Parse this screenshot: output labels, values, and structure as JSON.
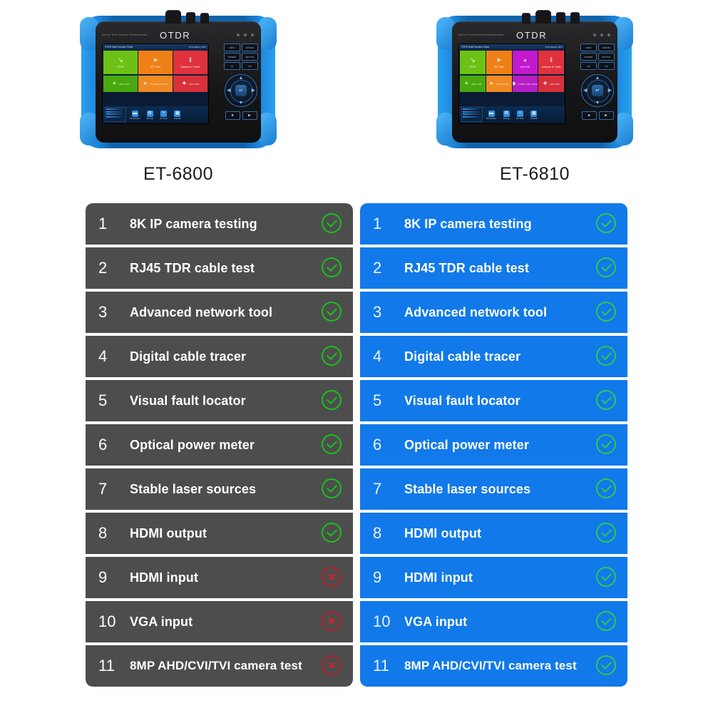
{
  "products": [
    {
      "label": "ET-6800",
      "device": {
        "brand_main": "OTDR",
        "brand_sub": "Optical Time Domain Reflectometer",
        "screen_title": "OTDR Multi-Function Tester",
        "screen_status": "12:06   Battery 86%",
        "tile_columns": 3,
        "tiles_top": [
          {
            "name": "OTDR",
            "icon": "otdr-trace-icon",
            "glyph": "↘",
            "color": "#6cc114"
          },
          {
            "name": "IPC Test",
            "icon": "ipc-camera-icon",
            "glyph": "➤",
            "color": "#ef8018"
          },
          {
            "name": "Network & Cable",
            "icon": "network-cable-icon",
            "glyph": "‖",
            "color": "#e0323c"
          }
        ],
        "tiles_bottom": [
          {
            "name": "Fiber Tool",
            "icon": "fiber-tool-icon",
            "glyph": "✴",
            "color": "#4aa80f"
          },
          {
            "name": "IP Discovery Tool",
            "icon": "discovery-icon",
            "glyph": "➤",
            "color": "#f08a22"
          },
          {
            "name": "Apk APPs",
            "icon": "apps-icon",
            "glyph": "❖",
            "color": "#d8303a"
          }
        ],
        "dock": [
          {
            "label": "File Explorer",
            "icon": "folder-icon",
            "glyph": "▬"
          },
          {
            "label": "Settings",
            "icon": "gear-icon",
            "glyph": "⚙"
          },
          {
            "label": "Net Tools",
            "icon": "network-icon",
            "glyph": "⑂"
          },
          {
            "label": "Calendar",
            "icon": "calendar-icon",
            "glyph": "▦"
          }
        ],
        "keypad_buttons": [
          "MENU",
          "RETURN",
          "SCREEN",
          "SETTING",
          "VFL",
          "PM"
        ],
        "keypad_bottom": [
          "■",
          "▶"
        ]
      }
    },
    {
      "label": "ET-6810",
      "device": {
        "brand_main": "OTDR",
        "brand_sub": "Optical Time Domain Reflectometer",
        "screen_title": "OTDR Multi-Function Tester",
        "screen_status": "12:06   Battery 86%",
        "tile_columns": 4,
        "tiles_top": [
          {
            "name": "OTDR",
            "icon": "otdr-trace-icon",
            "glyph": "↘",
            "color": "#6cc114"
          },
          {
            "name": "IPC Test",
            "icon": "ipc-camera-icon",
            "glyph": "➤",
            "color": "#ef8018"
          },
          {
            "name": "Auto HD",
            "icon": "auto-hd-icon",
            "glyph": "◕",
            "color": "#c418cf"
          },
          {
            "name": "Network & Cable",
            "icon": "network-cable-icon",
            "glyph": "‖",
            "color": "#e0323c"
          }
        ],
        "tiles_bottom": [
          {
            "name": "Fiber Tool",
            "icon": "fiber-tool-icon",
            "glyph": "✴",
            "color": "#4aa80f"
          },
          {
            "name": "IP Discovery",
            "icon": "discovery-icon",
            "glyph": "➤",
            "color": "#f08a22"
          },
          {
            "name": "CVBS & HD Coaxial",
            "icon": "coax-icon",
            "glyph": "◉",
            "color": "#b61ec4"
          },
          {
            "name": "Apk APPs",
            "icon": "apps-icon",
            "glyph": "❖",
            "color": "#d8303a"
          }
        ],
        "dock": [
          {
            "label": "File Explorer",
            "icon": "folder-icon",
            "glyph": "▬"
          },
          {
            "label": "Settings",
            "icon": "gear-icon",
            "glyph": "⚙"
          },
          {
            "label": "Net Tools",
            "icon": "network-icon",
            "glyph": "⑂"
          },
          {
            "label": "Calendar",
            "icon": "calendar-icon",
            "glyph": "▦"
          }
        ],
        "keypad_buttons": [
          "MENU",
          "RETURN",
          "SCREEN",
          "SETTING",
          "VFL",
          "PM"
        ],
        "keypad_bottom": [
          "■",
          "▶"
        ]
      }
    }
  ],
  "comparison": {
    "features": [
      "8K IP camera testing",
      "RJ45 TDR cable test",
      "Advanced network tool",
      "Digital cable tracer",
      "Visual fault locator",
      "Optical power meter",
      "Stable laser sources",
      "HDMI output",
      "HDMI input",
      "VGA input",
      "8MP AHD/CVI/TVI camera test"
    ],
    "numbers": [
      "1",
      "2",
      "3",
      "4",
      "5",
      "6",
      "7",
      "8",
      "9",
      "10",
      "11"
    ],
    "left": {
      "model": "ET-6800",
      "theme": "dark",
      "background": "#4d4d4d",
      "marks": [
        "yes",
        "yes",
        "yes",
        "yes",
        "yes",
        "yes",
        "yes",
        "yes",
        "no",
        "no",
        "no"
      ]
    },
    "right": {
      "model": "ET-6810",
      "theme": "blue",
      "background": "#1179ea",
      "marks": [
        "yes",
        "yes",
        "yes",
        "yes",
        "yes",
        "yes",
        "yes",
        "yes",
        "yes",
        "yes",
        "yes"
      ]
    },
    "mark_icons": {
      "yes": "check-circle-icon",
      "no": "x-circle-icon"
    },
    "colors": {
      "check_green": "#17c21c",
      "cross_red": "#b32028",
      "dark_row": "#4d4d4d",
      "blue_row": "#1179ea"
    }
  }
}
